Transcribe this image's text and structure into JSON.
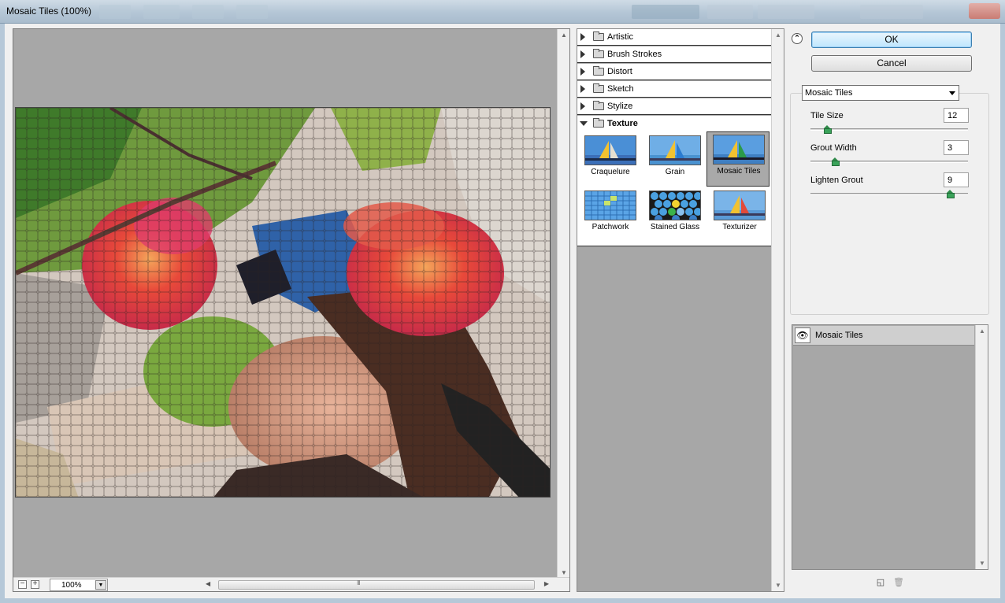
{
  "window": {
    "title": "Mosaic Tiles (100%)"
  },
  "preview": {
    "zoom_out_label": "−",
    "zoom_in_label": "+",
    "zoom_value": "100%",
    "scroll_grip": "III"
  },
  "gallery": {
    "categories": [
      {
        "label": "Artistic",
        "expanded": false
      },
      {
        "label": "Brush Strokes",
        "expanded": false
      },
      {
        "label": "Distort",
        "expanded": false
      },
      {
        "label": "Sketch",
        "expanded": false
      },
      {
        "label": "Stylize",
        "expanded": false
      },
      {
        "label": "Texture",
        "expanded": true
      }
    ],
    "texture_filters": [
      {
        "label": "Craquelure",
        "selected": false
      },
      {
        "label": "Grain",
        "selected": false
      },
      {
        "label": "Mosaic Tiles",
        "selected": true
      },
      {
        "label": "Patchwork",
        "selected": false
      },
      {
        "label": "Stained Glass",
        "selected": false
      },
      {
        "label": "Texturizer",
        "selected": false
      }
    ]
  },
  "buttons": {
    "ok": "OK",
    "cancel": "Cancel"
  },
  "filter_select": {
    "value": "Mosaic Tiles"
  },
  "params": [
    {
      "label": "Tile Size",
      "value": "12",
      "slider_fraction": 0.09
    },
    {
      "label": "Grout Width",
      "value": "3",
      "slider_fraction": 0.14
    },
    {
      "label": "Lighten Grout",
      "value": "9",
      "slider_fraction": 0.9
    }
  ],
  "layers": {
    "items": [
      {
        "label": "Mosaic Tiles"
      }
    ]
  },
  "colors": {
    "ok_accent": "#3c7fb1",
    "slider_knob": "#3aa35a",
    "canvas_gray": "#a7a7a7"
  }
}
